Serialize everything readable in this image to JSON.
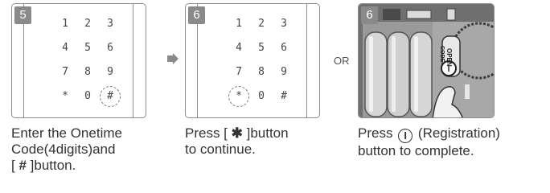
{
  "steps": [
    {
      "number": "5",
      "keys": [
        "1",
        "2",
        "3",
        "4",
        "5",
        "6",
        "7",
        "8",
        "9",
        "*",
        "0",
        "#"
      ],
      "caption": {
        "line1": "Enter the Onetime",
        "line2": "Code(4digits)and",
        "line3_pre": "[ ",
        "symbol": "#",
        "line3_post": " ]button."
      }
    },
    {
      "number": "6",
      "keys": [
        "1",
        "2",
        "3",
        "4",
        "5",
        "6",
        "7",
        "8",
        "9",
        "*",
        "0",
        "#"
      ],
      "caption": {
        "line1_pre": "Press [ ",
        "symbol": "✱",
        "line1_post": " ]button",
        "line2": "to continue."
      }
    },
    {
      "number": "6",
      "caption": {
        "line1_pre": "Press ",
        "icon": "I",
        "line1_post": " (Registration)",
        "line2": "button to complete."
      },
      "device_labels": {
        "open": "OPEN",
        "code": "CODE"
      }
    }
  ],
  "connector": {
    "arrow": "right-arrow-icon",
    "or": "OR"
  },
  "colors": {
    "badge": "#8a8a8a",
    "border": "#8c8c8c",
    "text": "#333333"
  }
}
